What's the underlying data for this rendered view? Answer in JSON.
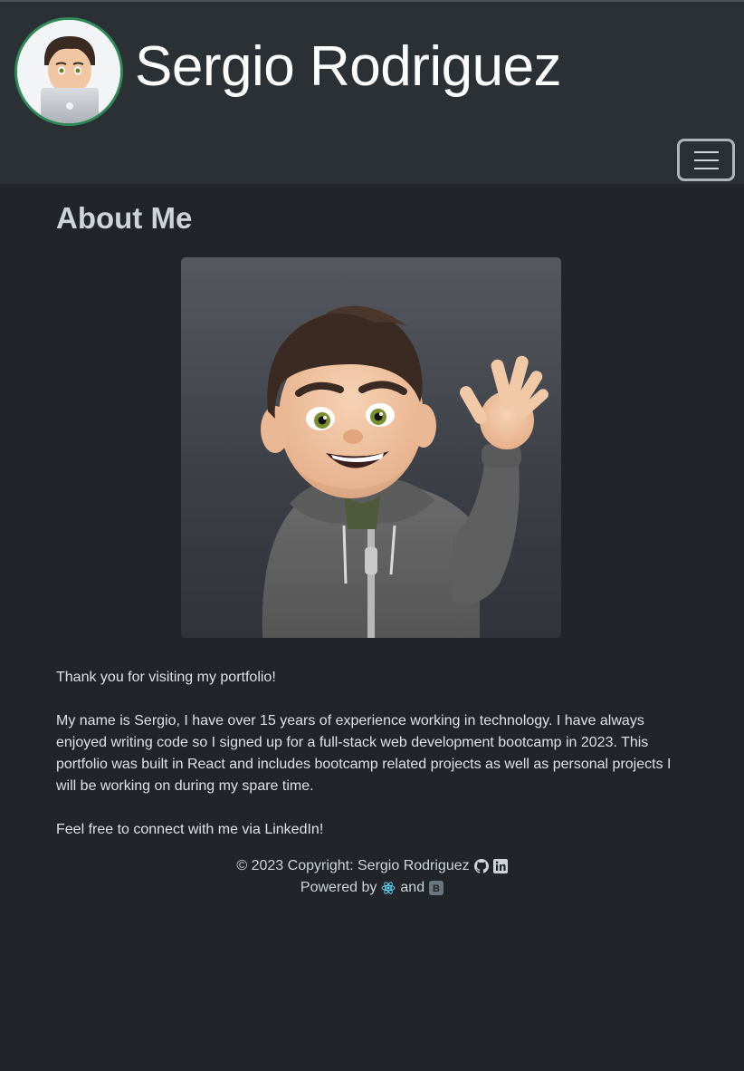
{
  "header": {
    "name": "Sergio Rodriguez",
    "avatar_icon": "memoji-laptop-avatar",
    "menu_icon": "hamburger-menu-icon"
  },
  "main": {
    "title": "About Me",
    "image_icon": "memoji-waving-portrait",
    "paragraphs": [
      "Thank you for visiting my portfolio!",
      "My name is Sergio, I have over 15 years of experience working in technology. I have always enjoyed writing code so I signed up for a full-stack web development bootcamp in 2023. This portfolio was built in React and includes bootcamp related projects as well as personal projects I will be working on during my spare time.",
      "Feel free to connect with me via LinkedIn!"
    ]
  },
  "footer": {
    "copyright": "© 2023 Copyright: Sergio Rodriguez",
    "powered_by": "Powered by",
    "and": "and",
    "icons": [
      "github-icon",
      "linkedin-icon",
      "react-icon",
      "bootstrap-icon"
    ]
  },
  "colors": {
    "page_bg": "#212529",
    "navbar_bg": "#2b3035",
    "avatar_border": "#2e8b57",
    "text": "#dee2e6"
  }
}
